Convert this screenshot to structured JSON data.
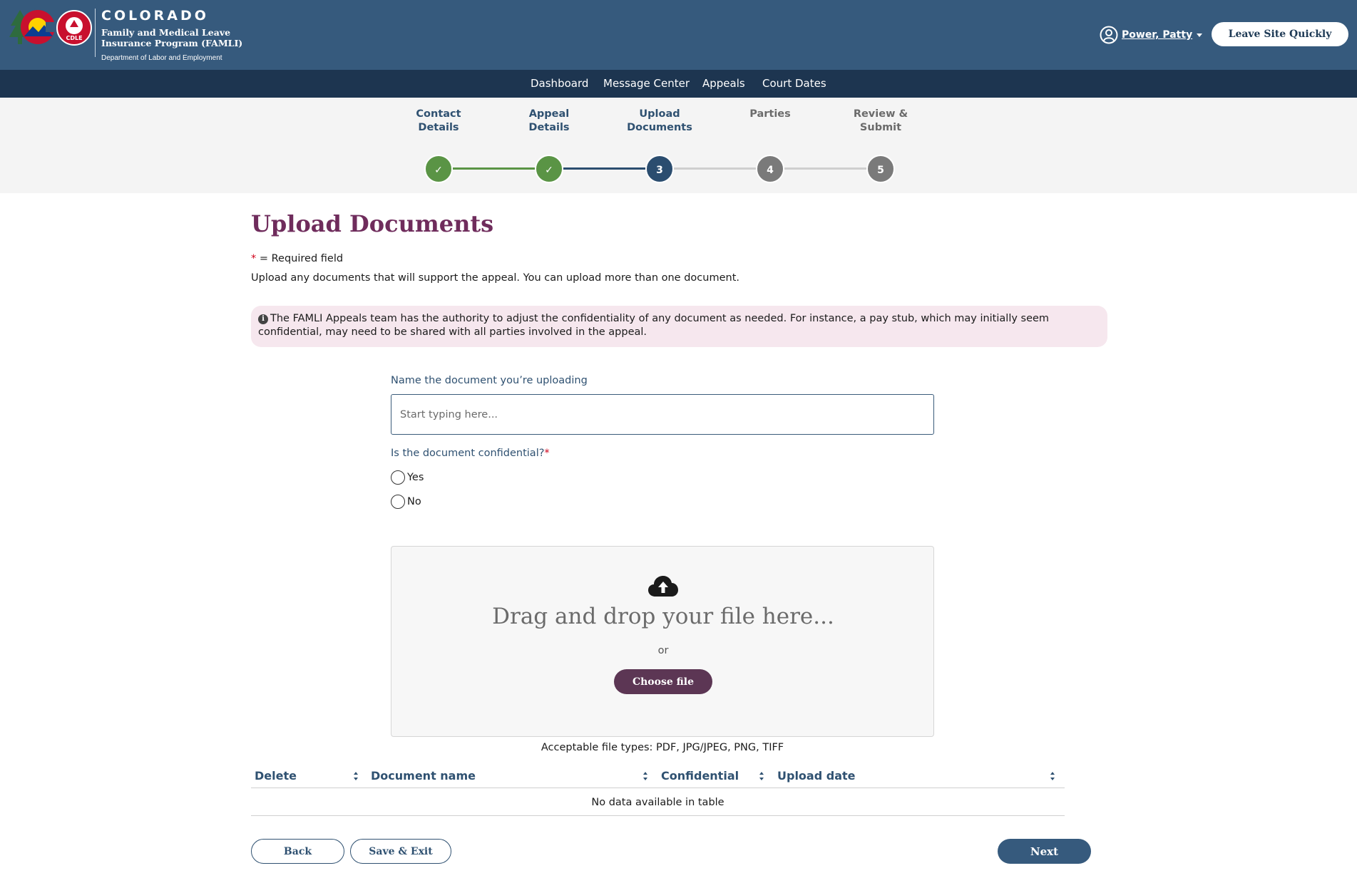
{
  "header": {
    "brand_state": "COLORADO",
    "brand_program_line1": "Family and Medical Leave",
    "brand_program_line2": "Insurance Program (FAMLI)",
    "brand_dept": "Department of Labor and Employment",
    "logo_badge": "CDLE",
    "user_name": "Power, Patty",
    "leave_button": "Leave Site Quickly"
  },
  "nav": {
    "items": [
      "Dashboard",
      "Message Center",
      "Appeals",
      "Court Dates"
    ]
  },
  "stepper": {
    "steps": [
      {
        "line1": "Contact",
        "line2": "Details",
        "status": "complete",
        "marker": "✓"
      },
      {
        "line1": "Appeal",
        "line2": "Details",
        "status": "complete",
        "marker": "✓"
      },
      {
        "line1": "Upload",
        "line2": "Documents",
        "status": "current",
        "marker": "3"
      },
      {
        "line1": "Parties",
        "line2": "",
        "status": "upcoming",
        "marker": "4"
      },
      {
        "line1": "Review &",
        "line2": "Submit",
        "status": "upcoming",
        "marker": "5"
      }
    ]
  },
  "page": {
    "title": "Upload Documents",
    "required_star": "*",
    "required_note": " = Required field",
    "intro": "Upload any documents that will support the appeal. You can upload more than one document.",
    "alert_text": "The FAMLI Appeals team has the authority to adjust the confidentiality of any document as needed. For instance, a pay stub, which may initially seem confidential, may need to be shared with all parties involved in the appeal."
  },
  "form": {
    "name_label": "Name the document you’re uploading",
    "name_placeholder": "Start typing here...",
    "name_value": "",
    "confidential_label": "Is the document confidential?",
    "confidential_star": "*",
    "options": [
      "Yes",
      "No"
    ]
  },
  "dropzone": {
    "text": "Drag and drop your file here...",
    "or": "or",
    "choose_button": "Choose file",
    "file_types": "Acceptable file types: PDF, JPG/JPEG, PNG, TIFF"
  },
  "table": {
    "columns": [
      "Delete",
      "Document name",
      "Confidential",
      "Upload date"
    ],
    "empty_message": "No data available in table"
  },
  "actions": {
    "back": "Back",
    "save_exit": "Save & Exit",
    "next": "Next"
  },
  "colors": {
    "header_bg": "#365a7d",
    "nav_bg": "#1d3550",
    "complete": "#5a9445",
    "current": "#2b4d6f",
    "upcoming": "#7a7a7a",
    "title": "#6f2c5c",
    "choose_button": "#5c3654"
  }
}
